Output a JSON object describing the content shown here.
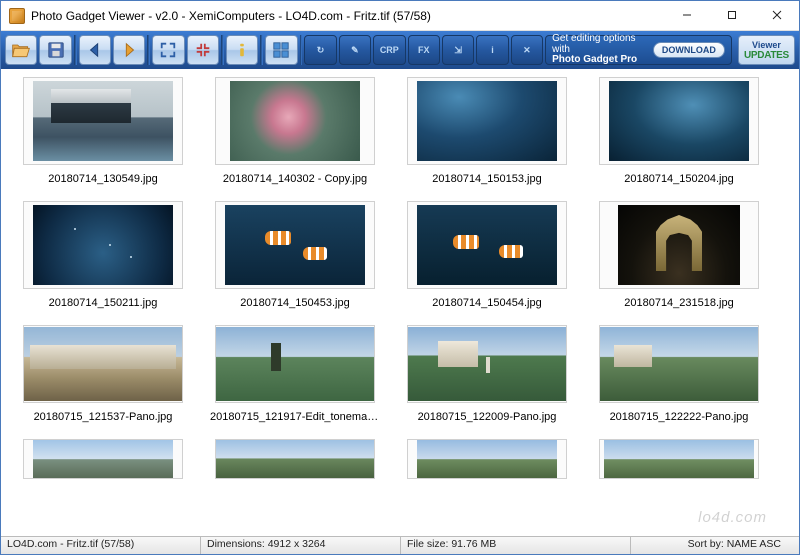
{
  "window": {
    "title": "Photo Gadget Viewer - v2.0 - XemiComputers - LO4D.com - Fritz.tif (57/58)"
  },
  "toolbar": {
    "buttons": [
      {
        "name": "open",
        "icon": "folder"
      },
      {
        "name": "save",
        "icon": "disk"
      },
      {
        "name": "prev",
        "icon": "arrow-left"
      },
      {
        "name": "next",
        "icon": "arrow-right"
      },
      {
        "name": "fullscreen",
        "icon": "expand"
      },
      {
        "name": "fit",
        "icon": "contract"
      },
      {
        "name": "info",
        "icon": "info"
      },
      {
        "name": "thumbs",
        "icon": "grid"
      }
    ],
    "dark": [
      {
        "name": "rotate",
        "label": "↻"
      },
      {
        "name": "edit",
        "label": "✎"
      },
      {
        "name": "crop",
        "label": "CRP"
      },
      {
        "name": "fx",
        "label": "FX"
      },
      {
        "name": "resize",
        "label": "⇲"
      },
      {
        "name": "meta",
        "label": "i"
      },
      {
        "name": "delete",
        "label": "✕"
      }
    ],
    "promo_line1": "Get editing options with",
    "promo_line2": "Photo Gadget Pro",
    "download": "DOWNLOAD",
    "updates_l1": "Viewer",
    "updates_l2": "UPDATES"
  },
  "thumbs": [
    {
      "file": "20180714_130549.jpg",
      "art": "t-harbor"
    },
    {
      "file": "20180714_140302 - Copy.jpg",
      "art": "t-starfish"
    },
    {
      "file": "20180714_150153.jpg",
      "art": "t-aqua1"
    },
    {
      "file": "20180714_150204.jpg",
      "art": "t-aqua2"
    },
    {
      "file": "20180714_150211.jpg",
      "art": "t-aqua3"
    },
    {
      "file": "20180714_150453.jpg",
      "art": "t-clown1"
    },
    {
      "file": "20180714_150454.jpg",
      "art": "t-clown2"
    },
    {
      "file": "20180714_231518.jpg",
      "art": "t-arch"
    },
    {
      "file": "20180715_121537-Pano.jpg",
      "art": "t-pano1",
      "row": "row4"
    },
    {
      "file": "20180715_121917-Edit_tonemappe...",
      "art": "t-pano2",
      "row": "row4"
    },
    {
      "file": "20180715_122009-Pano.jpg",
      "art": "t-pano3",
      "row": "row4"
    },
    {
      "file": "20180715_122222-Pano.jpg",
      "art": "t-pano4",
      "row": "row4"
    },
    {
      "file": "",
      "art": "t-partial1",
      "row": "row5"
    },
    {
      "file": "",
      "art": "t-partial2",
      "row": "row5"
    },
    {
      "file": "",
      "art": "t-partial3",
      "row": "row5"
    },
    {
      "file": "",
      "art": "t-partial4",
      "row": "row5"
    }
  ],
  "status": {
    "file": "LO4D.com - Fritz.tif (57/58)",
    "dimensions": "Dimensions:  4912 x 3264",
    "filesize": "File size: 91.76 MB",
    "sort": "Sort by: NAME ASC"
  },
  "watermark": "lo4d.com"
}
